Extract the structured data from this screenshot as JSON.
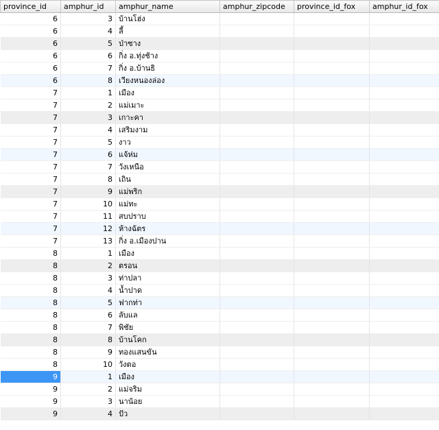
{
  "columns": [
    "province_id",
    "amphur_id",
    "amphur_name",
    "amphur_zipcode",
    "province_id_fox",
    "amphur_id_fox"
  ],
  "selected_row": 29,
  "rows": [
    {
      "province_id": "6",
      "amphur_id": "3",
      "amphur_name": "บ้านโฮ่ง",
      "style": "normal"
    },
    {
      "province_id": "6",
      "amphur_id": "4",
      "amphur_name": "ลี้",
      "style": "normal"
    },
    {
      "province_id": "6",
      "amphur_id": "5",
      "amphur_name": "ป่าซาง",
      "style": "alt"
    },
    {
      "province_id": "6",
      "amphur_id": "6",
      "amphur_name": "กิ่ง อ.ทุ่งช้าง",
      "style": "normal"
    },
    {
      "province_id": "6",
      "amphur_id": "7",
      "amphur_name": "กิ่ง อ.บ้านธิ",
      "style": "normal"
    },
    {
      "province_id": "6",
      "amphur_id": "8",
      "amphur_name": "เวียงหนองล่อง",
      "style": "hl"
    },
    {
      "province_id": "7",
      "amphur_id": "1",
      "amphur_name": "เมือง",
      "style": "normal"
    },
    {
      "province_id": "7",
      "amphur_id": "2",
      "amphur_name": "แม่เมาะ",
      "style": "normal"
    },
    {
      "province_id": "7",
      "amphur_id": "3",
      "amphur_name": "เกาะคา",
      "style": "alt"
    },
    {
      "province_id": "7",
      "amphur_id": "4",
      "amphur_name": "เสริมงาม",
      "style": "normal"
    },
    {
      "province_id": "7",
      "amphur_id": "5",
      "amphur_name": "งาว",
      "style": "normal"
    },
    {
      "province_id": "7",
      "amphur_id": "6",
      "amphur_name": "แจ้ห่ม",
      "style": "hl"
    },
    {
      "province_id": "7",
      "amphur_id": "7",
      "amphur_name": "วังเหนือ",
      "style": "normal"
    },
    {
      "province_id": "7",
      "amphur_id": "8",
      "amphur_name": "เถิน",
      "style": "normal"
    },
    {
      "province_id": "7",
      "amphur_id": "9",
      "amphur_name": "แม่พริก",
      "style": "alt"
    },
    {
      "province_id": "7",
      "amphur_id": "10",
      "amphur_name": "แม่ทะ",
      "style": "normal"
    },
    {
      "province_id": "7",
      "amphur_id": "11",
      "amphur_name": "สบปราบ",
      "style": "normal"
    },
    {
      "province_id": "7",
      "amphur_id": "12",
      "amphur_name": "ห้างฉัตร",
      "style": "hl"
    },
    {
      "province_id": "7",
      "amphur_id": "13",
      "amphur_name": "กิ่ง อ.เมืองปาน",
      "style": "normal"
    },
    {
      "province_id": "8",
      "amphur_id": "1",
      "amphur_name": "เมือง",
      "style": "normal"
    },
    {
      "province_id": "8",
      "amphur_id": "2",
      "amphur_name": "ตรอน",
      "style": "alt"
    },
    {
      "province_id": "8",
      "amphur_id": "3",
      "amphur_name": "ท่าปลา",
      "style": "normal"
    },
    {
      "province_id": "8",
      "amphur_id": "4",
      "amphur_name": "น้ำปาด",
      "style": "normal"
    },
    {
      "province_id": "8",
      "amphur_id": "5",
      "amphur_name": "ฟากท่า",
      "style": "hl"
    },
    {
      "province_id": "8",
      "amphur_id": "6",
      "amphur_name": "ลับแล",
      "style": "normal"
    },
    {
      "province_id": "8",
      "amphur_id": "7",
      "amphur_name": "พิชัย",
      "style": "normal"
    },
    {
      "province_id": "8",
      "amphur_id": "8",
      "amphur_name": "บ้านโคก",
      "style": "alt"
    },
    {
      "province_id": "8",
      "amphur_id": "9",
      "amphur_name": "ทองแสนขัน",
      "style": "normal"
    },
    {
      "province_id": "8",
      "amphur_id": "10",
      "amphur_name": "วังตอ",
      "style": "normal"
    },
    {
      "province_id": "9",
      "amphur_id": "1",
      "amphur_name": "เมือง",
      "style": "hl"
    },
    {
      "province_id": "9",
      "amphur_id": "2",
      "amphur_name": "แม่จริม",
      "style": "normal"
    },
    {
      "province_id": "9",
      "amphur_id": "3",
      "amphur_name": "นาน้อย",
      "style": "normal"
    },
    {
      "province_id": "9",
      "amphur_id": "4",
      "amphur_name": "ปัว",
      "style": "alt"
    }
  ]
}
